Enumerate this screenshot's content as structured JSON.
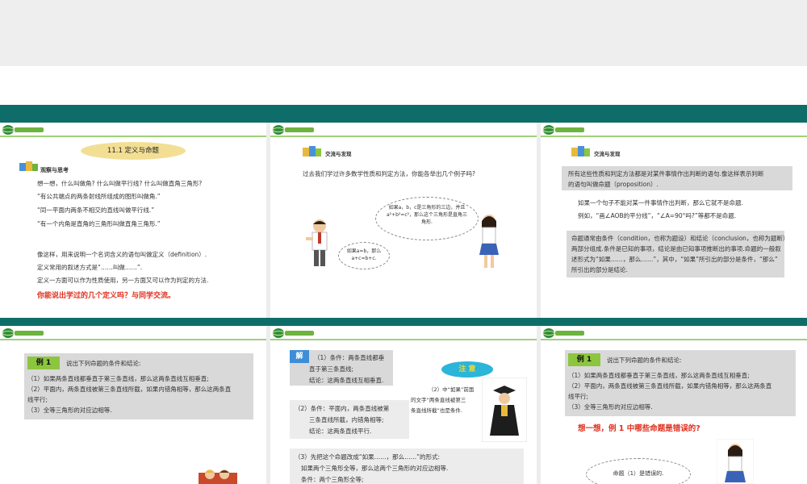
{
  "colors": {
    "teal": "#0e6d68",
    "green": "#8cc63f",
    "red": "#e0301e",
    "oval": "#f2df94",
    "blue": "#3c8ed6"
  },
  "logo": {
    "text": "Zhong Edu.com",
    "icon": "globe-logo-icon"
  },
  "slide1": {
    "title": "11.1  定义与命题",
    "section": "观察与思考",
    "lines": [
      "想一想，什么叫做角? 什么叫做平行线? 什么叫做直角三角形?",
      "“有公共端点的两条射线所组成的图形叫做角.”",
      "“同一平面内两条不相交的直线叫做平行线.”",
      "“有一个内角是直角的三角形叫做直角三角形.”"
    ],
    "def_lines": [
      "像这样，用来说明一个名词含义的语句叫做定义（definition）.",
      "定义常用的叙述方式是“……叫做……”.",
      "定义一方面可以作为性质使用，另一方面又可以作为判定的方法."
    ],
    "prompt": "你能说出学过的几个定义吗？与同学交流。"
  },
  "slide2": {
    "section": "交流与发现",
    "question": "过去我们学过许多数学性质和判定方法，你能各举出几个例子吗?",
    "cloud_right": "如果a，b，c是三角形的三边，并且a²+b²=c²，那么这个三角形是直角三角形.",
    "cloud_left": "如果a=b，那么a+c=b+c."
  },
  "slide3": {
    "section": "交流与发现",
    "para1": [
      "所有这些性质和判定方法都是对某件事情作出判断的语句.像这样表示判断",
      "的语句叫做命题（proposition）."
    ],
    "para2": [
      "如果一个句子不能对某一件事情作出判断，那么它就不是命题.",
      "例如，“画∠AOB的平分线”，“∠A=90°吗?”等都不是命题."
    ],
    "para3": [
      "命题通常由条件（condition，也称为题设）和结论（conclusion，也称为题断）",
      "两部分组成.条件是已知的事项，结论是由已知事项推断出的事项.命题的一般叙",
      "述形式为“如果……，那么……”，其中，“如果”所引出的部分是条件，“那么”",
      "所引出的部分是结论."
    ]
  },
  "slide4": {
    "tag": "例 1",
    "heading": "说出下列命题的条件和结论:",
    "items": [
      "（1）如果两条直线都垂直于第三条直线，那么这两条直线互相垂直;",
      "（2）平面内，两条直线被第三条直线所截，如果内错角相等，那么这两条直",
      "线平行;",
      "（3）全等三角形的对应边相等."
    ]
  },
  "slide5": {
    "tag": "解",
    "part1": [
      "（1）条件：两条直线都垂",
      "直于第三条直线;",
      "结论：这两条直线互相垂直."
    ],
    "note_title": "注    意",
    "note": [
      "（2）中“如果”前面",
      "的文字“两条直线被第三",
      "条直线所截”也是条件."
    ],
    "part2": [
      "（2）条件：平面内，两条直线被第",
      "三条直线所截，内错角相等;",
      "结论：这两条直线平行."
    ],
    "part3": [
      "（3）先把这个命题改成“如果……，那么……”的形式:",
      "如果两个三角形全等，那么这两个三角形的对应边相等.",
      "条件：两个三角形全等;"
    ]
  },
  "slide6": {
    "tag": "例 1",
    "heading": "说出下列命题的条件和结论:",
    "items": [
      "（1）如果两条直线都垂直于第三条直线，那么这两条直线互相垂直;",
      "（2）平面内，两条直线被第三条直线所截，如果内错角相等，那么这两条直",
      "线平行;",
      "（3）全等三角形的对应边相等."
    ],
    "question": "想一想，例 1 中哪些命题是错误的?",
    "cloud": "命题（1）是错误的."
  }
}
